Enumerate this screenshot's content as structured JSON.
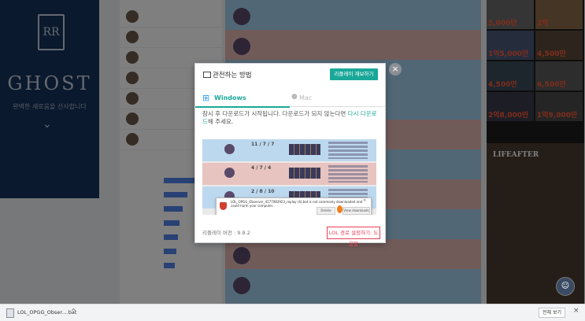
{
  "left_ad": {
    "brand_initials": "RR",
    "headline": "GHOST",
    "slogan": "완벽한 새로움을 선사합니다",
    "chevron": "⌄"
  },
  "right_ad": {
    "prizes": [
      "5,000만",
      "2억",
      "1억5,000만",
      "4,500만",
      "4,500만",
      "6,500만",
      "2억8,000만",
      "1억9,000만"
    ],
    "game_title": "LIFEAFTER"
  },
  "modal": {
    "title": "관전하는 방법",
    "replay_button": "리플레이 재보하기",
    "tab_windows": "Windows",
    "tab_mac": "Mac",
    "description_pre": "잠시 후 다운로드가 시작됩니다. 다운로드가 되지 않는다면 ",
    "description_link": "다시 다운로드",
    "description_post": "해 주세요.",
    "version": "리플레이 버전 : 9.8.2",
    "lol_settings": "LOL 경로 설정하기: 도움말",
    "close": "×"
  },
  "preview": {
    "scores": [
      "11 / 7 / 7",
      "4 / 7 / 4",
      "2 / 8 / 10"
    ],
    "dialog_message": "LOL_OPGG_Observer_4177082923_replay (4).bat is not commonly downloaded and could harm your computer.",
    "discard": "Delete",
    "view_downloads": "View downloads",
    "dialog_close": "×"
  },
  "download_bar": {
    "file_name": "LOL_OPGG_Obser....bat",
    "chevron": "^",
    "show_all": "전체 보기",
    "close": "×"
  },
  "chat_icon": "☺",
  "colors": {
    "accent": "#1aa898",
    "danger": "#e84057",
    "win": "#a3cfec",
    "loss": "#e2b6b3"
  }
}
